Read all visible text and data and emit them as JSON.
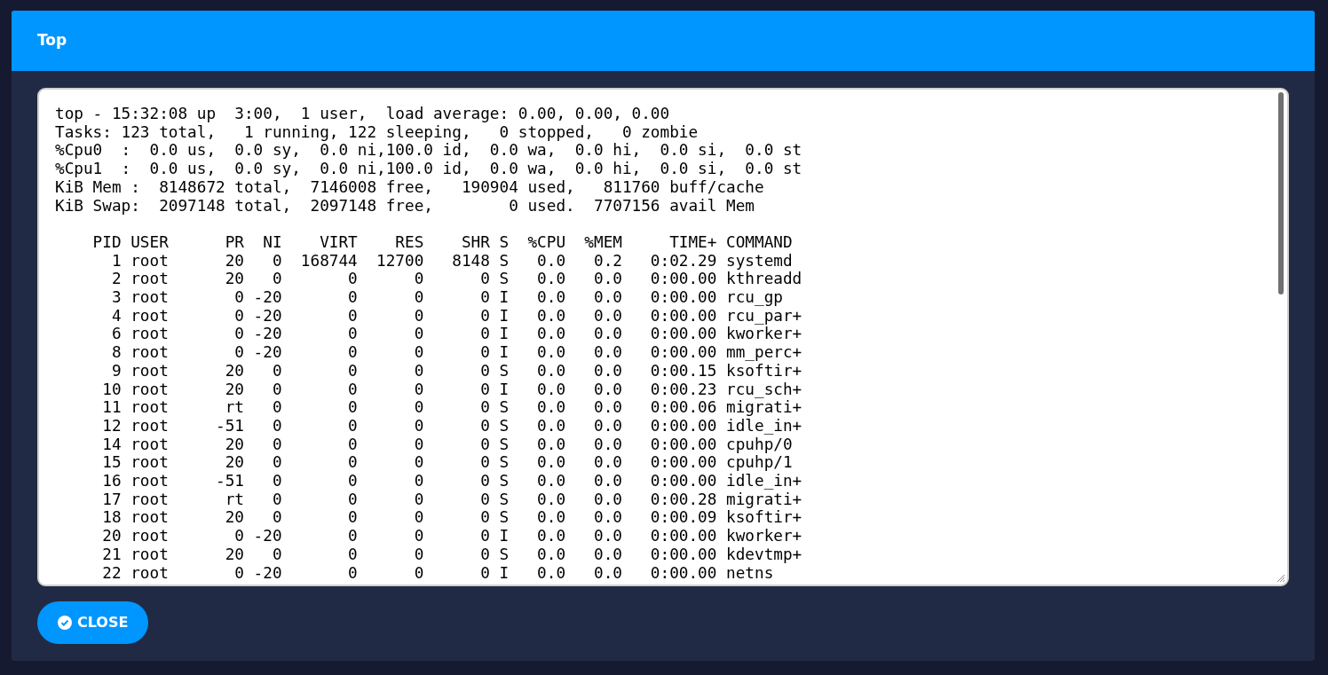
{
  "dialog": {
    "title": "Top"
  },
  "output": {
    "summary_lines": [
      "top - 15:32:08 up  3:00,  1 user,  load average: 0.00, 0.00, 0.00",
      "Tasks: 123 total,   1 running, 122 sleeping,   0 stopped,   0 zombie",
      "%Cpu0  :  0.0 us,  0.0 sy,  0.0 ni,100.0 id,  0.0 wa,  0.0 hi,  0.0 si,  0.0 st",
      "%Cpu1  :  0.0 us,  0.0 sy,  0.0 ni,100.0 id,  0.0 wa,  0.0 hi,  0.0 si,  0.0 st",
      "KiB Mem :  8148672 total,  7146008 free,   190904 used,   811760 buff/cache",
      "KiB Swap:  2097148 total,  2097148 free,        0 used.  7707156 avail Mem"
    ],
    "table_header": "    PID USER      PR  NI    VIRT    RES    SHR S  %CPU  %MEM     TIME+ COMMAND",
    "table_rows": [
      "      1 root      20   0  168744  12700   8148 S   0.0   0.2   0:02.29 systemd",
      "      2 root      20   0       0      0      0 S   0.0   0.0   0:00.00 kthreadd",
      "      3 root       0 -20       0      0      0 I   0.0   0.0   0:00.00 rcu_gp",
      "      4 root       0 -20       0      0      0 I   0.0   0.0   0:00.00 rcu_par+",
      "      6 root       0 -20       0      0      0 I   0.0   0.0   0:00.00 kworker+",
      "      8 root       0 -20       0      0      0 I   0.0   0.0   0:00.00 mm_perc+",
      "      9 root      20   0       0      0      0 S   0.0   0.0   0:00.15 ksoftir+",
      "     10 root      20   0       0      0      0 I   0.0   0.0   0:00.23 rcu_sch+",
      "     11 root      rt   0       0      0      0 S   0.0   0.0   0:00.06 migrati+",
      "     12 root     -51   0       0      0      0 S   0.0   0.0   0:00.00 idle_in+",
      "     14 root      20   0       0      0      0 S   0.0   0.0   0:00.00 cpuhp/0",
      "     15 root      20   0       0      0      0 S   0.0   0.0   0:00.00 cpuhp/1",
      "     16 root     -51   0       0      0      0 S   0.0   0.0   0:00.00 idle_in+",
      "     17 root      rt   0       0      0      0 S   0.0   0.0   0:00.28 migrati+",
      "     18 root      20   0       0      0      0 S   0.0   0.0   0:00.09 ksoftir+",
      "     20 root       0 -20       0      0      0 I   0.0   0.0   0:00.00 kworker+",
      "     21 root      20   0       0      0      0 S   0.0   0.0   0:00.00 kdevtmp+",
      "     22 root       0 -20       0      0      0 I   0.0   0.0   0:00.00 netns"
    ]
  },
  "buttons": [
    {
      "label": "CLOSE"
    }
  ]
}
